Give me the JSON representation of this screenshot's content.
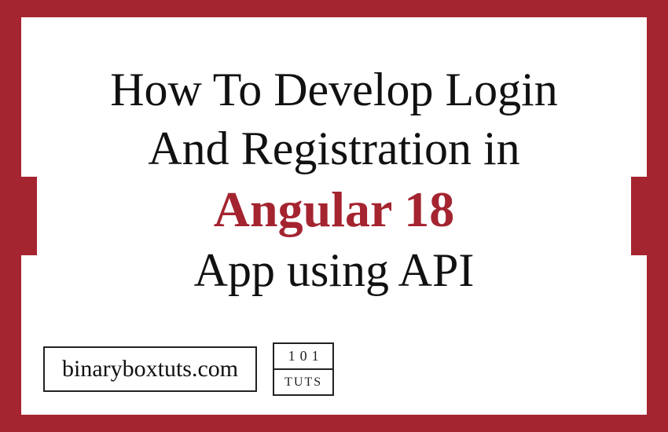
{
  "title": {
    "line1": "How To Develop Login",
    "line2": "And Registration in",
    "accent": "Angular 18",
    "line4": "App using API"
  },
  "footer": {
    "site": "binaryboxtuts.com",
    "logo_top": "101",
    "logo_bot": "TUTS"
  }
}
